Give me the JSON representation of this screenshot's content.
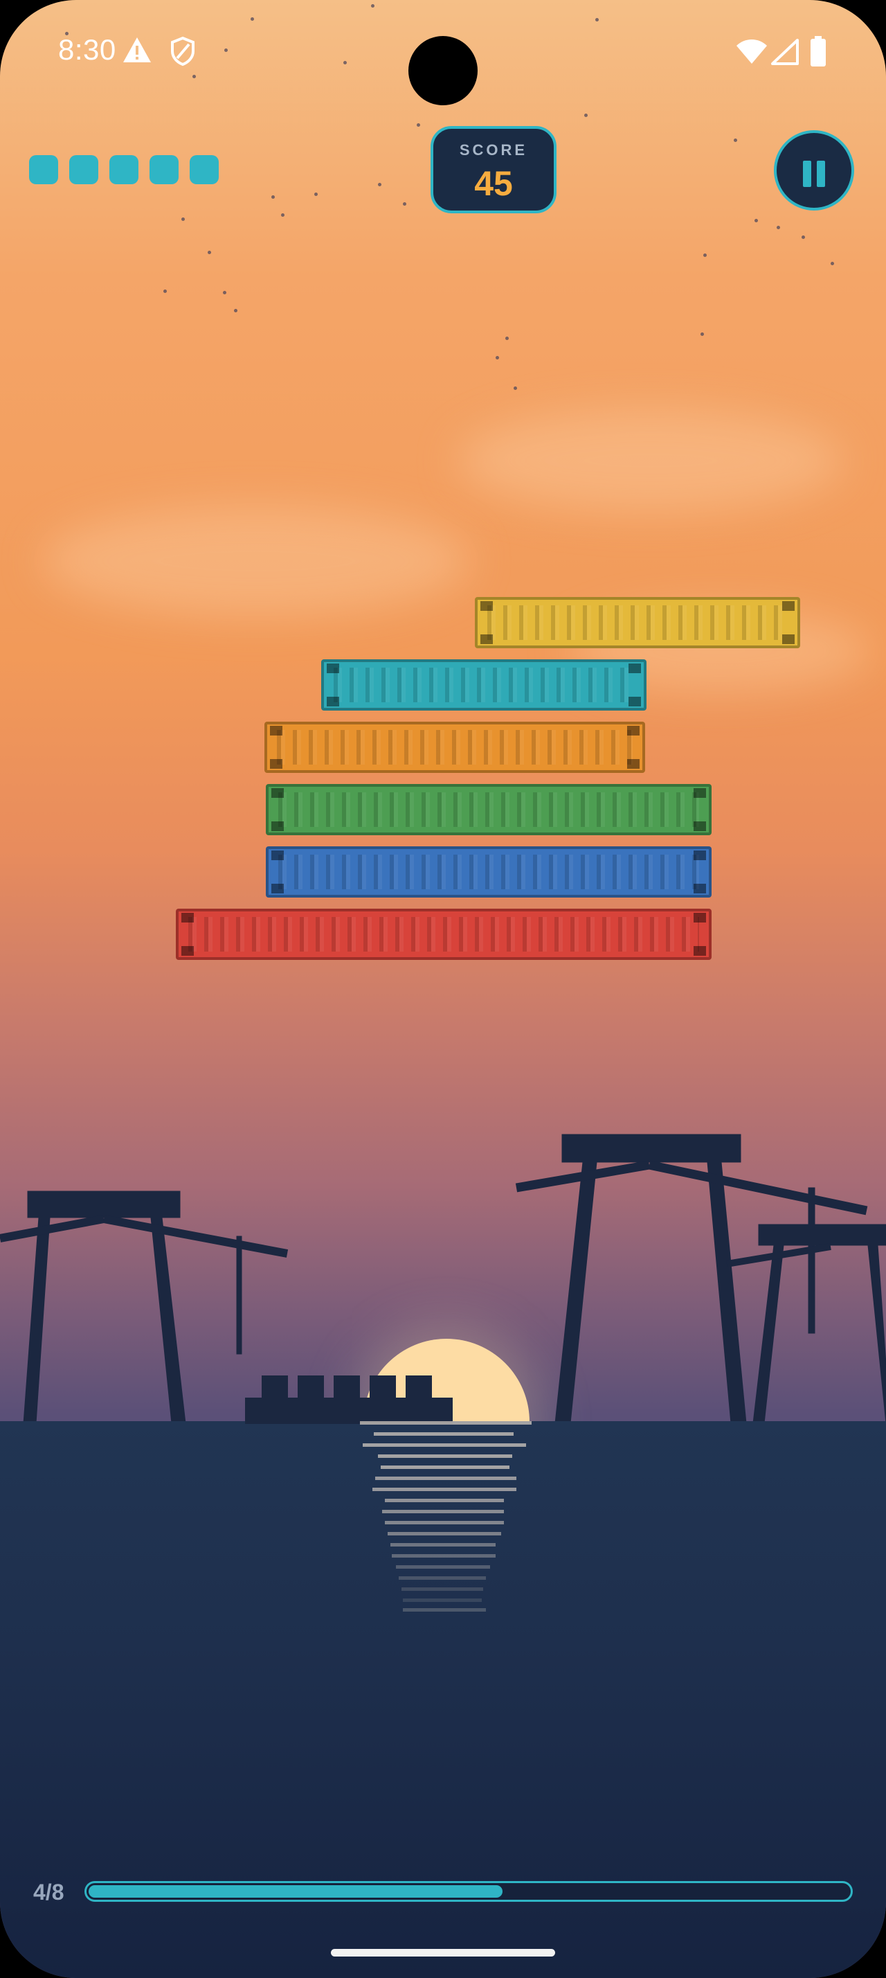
{
  "status_bar": {
    "time": "8:30",
    "left_icons": [
      "warning-icon",
      "shield-icon"
    ],
    "right_icons": [
      "wifi-icon",
      "cellular-signal-icon",
      "battery-icon"
    ]
  },
  "hud": {
    "lives_remaining": 5,
    "score_label": "SCORE",
    "score_value": "45",
    "pause_icon": "pause-icon",
    "accent_color": "#2fb5c5",
    "score_color": "#f6ac3f"
  },
  "stack": {
    "containers": [
      {
        "color": "yellow",
        "hex": "#e4b93a"
      },
      {
        "color": "teal",
        "hex": "#2faab6"
      },
      {
        "color": "orange",
        "hex": "#e8922e"
      },
      {
        "color": "green",
        "hex": "#4d9e52"
      },
      {
        "color": "blue",
        "hex": "#3a73bd"
      },
      {
        "color": "red",
        "hex": "#d8433a"
      }
    ]
  },
  "scene": {
    "elements": [
      "crane-silhouette",
      "ship-silhouette",
      "setting-sun",
      "sea",
      "sun-reflection"
    ]
  },
  "progress": {
    "label": "4/8",
    "fraction": 0.5
  }
}
